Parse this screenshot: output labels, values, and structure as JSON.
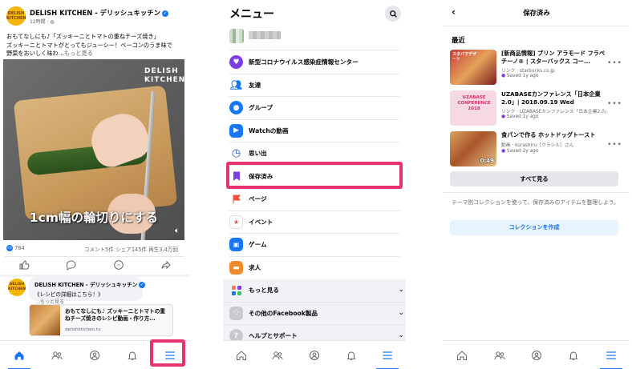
{
  "colors": {
    "accent": "#1877f2",
    "highlight": "#e8336e",
    "muted": "#65676b"
  },
  "panel1": {
    "page_name": "DELISH KITCHEN - デリッシュキッチン",
    "logo_text": "DELISH KITCHEN",
    "post_time": "12時間 · ",
    "caption_line1": "おもてなしにも♪「ズッキーニとトマトの重ねチーズ焼き」",
    "caption_line2": "ズッキーニとトマトがとってもジューシー！ベーコンのうま味で",
    "caption_line3": "野菜をおいしく味わ…",
    "caption_more": "もっと見る",
    "video_brand": "DELISH KITCHEN",
    "video_overlay_text": "1cm幅の輪切りにする",
    "like_count": "784",
    "stats_right": "コメント5件  シェア145件  再生3.4万回",
    "comment_name": "DELISH KITCHEN - デリッシュキッチン",
    "comment_text": "《レシピの詳細はこちら！》",
    "comment_ellipsis": "…",
    "comment_more": "もっと見る",
    "link_title": "おもてなしにも♪ ズッキーニとトマトの重ねチーズ焼きのレシピ動画・作り方...",
    "link_host": "delishkitchen.tv"
  },
  "panel2": {
    "title": "メニュー",
    "items": [
      {
        "label": "新型コロナウイルス感染症情報センター",
        "icon": "covid-shield-icon",
        "color": "#7b3fe4"
      },
      {
        "label": "友達",
        "icon": "friends-icon",
        "color": "#1877f2"
      },
      {
        "label": "グループ",
        "icon": "groups-icon",
        "color": "#1877f2"
      },
      {
        "label": "Watchの動画",
        "icon": "watch-icon",
        "color": "#1877f2"
      },
      {
        "label": "思い出",
        "icon": "memories-icon",
        "color": "#1f5fb8"
      },
      {
        "label": "保存済み",
        "icon": "saved-bookmark-icon",
        "color": "#7b3fe4"
      },
      {
        "label": "ページ",
        "icon": "pages-flag-icon",
        "color": "#f0523a"
      },
      {
        "label": "イベント",
        "icon": "events-calendar-icon",
        "color": "#f0523a"
      },
      {
        "label": "ゲーム",
        "icon": "gaming-icon",
        "color": "#1877f2"
      },
      {
        "label": "求人",
        "icon": "jobs-briefcase-icon",
        "color": "#f28a2b"
      },
      {
        "label": "もっと見る",
        "icon": "see-more-grid-icon",
        "color": "#ff7a59"
      },
      {
        "label": "その他のFacebook製品",
        "icon": "more-products-icon",
        "color": "#8a8d91"
      },
      {
        "label": "ヘルプとサポート",
        "icon": "help-icon",
        "color": "#8a8d91"
      }
    ]
  },
  "panel3": {
    "title": "保存済み",
    "section": "最近",
    "items": [
      {
        "title": "[新商品情報] プリン アラモード フラペチーノ® | スターバックス コー...",
        "sub": "リンク · starbucks.co.jp",
        "when": "Saved 1y ago",
        "thumb_text": "スタバでデザート"
      },
      {
        "title": "UZABASEカンファレンス「日本企業2.0」| 2018.09.19 Wed",
        "sub": "リンク · UZABASEカンファレンス「日本企業2.0」",
        "when": "Saved 1y ago",
        "thumb_text": "UZABASE CONFERENCE 2018"
      },
      {
        "title": "食パンで作る ホットドッグトースト",
        "sub": "動画 · kurashiru［クラシル］さん",
        "when": "Saved 2y ago",
        "duration": "0:49"
      }
    ],
    "see_all": "すべて見る",
    "hint": "テーマ別コレクションを使って、保存済みのアイテムを整理しよう。",
    "create_button": "コレクションを作成"
  }
}
